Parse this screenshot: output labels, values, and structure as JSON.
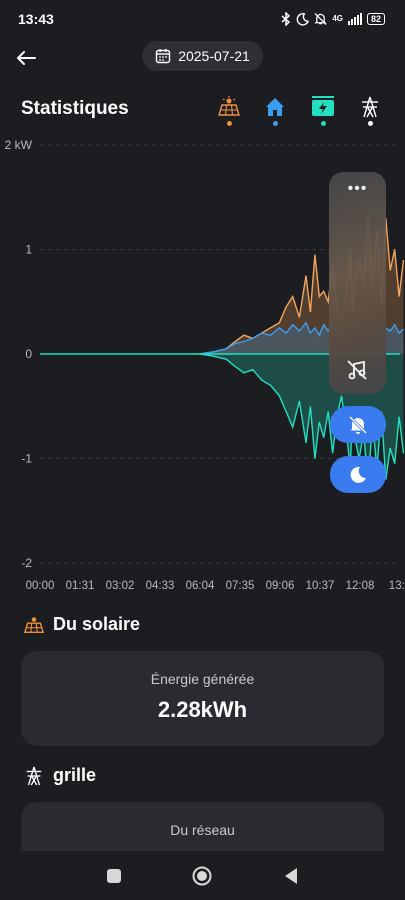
{
  "status_bar": {
    "time": "13:43",
    "network": "4G",
    "battery": "82"
  },
  "header": {
    "date": "2025-07-21",
    "title": "Statistiques"
  },
  "source_tabs": [
    {
      "name": "solar",
      "icon": "solar-panel-icon",
      "dot_color": "#f0923a"
    },
    {
      "name": "home",
      "icon": "home-icon",
      "dot_color": "#3a9ef0"
    },
    {
      "name": "battery",
      "icon": "battery-charging-icon",
      "dot_color": "#22e0c0"
    },
    {
      "name": "grid",
      "icon": "power-tower-icon",
      "dot_color": "#ffffff"
    }
  ],
  "chart_data": {
    "type": "line",
    "ylabel": "kW",
    "ylim": [
      -2,
      2
    ],
    "y_ticks": [
      "2 kW",
      "1",
      "0",
      "-1",
      "-2"
    ],
    "x_ticks": [
      "00:00",
      "01:31",
      "03:02",
      "04:33",
      "06:04",
      "07:35",
      "09:06",
      "10:37",
      "12:08",
      "13:3"
    ],
    "series": [
      {
        "id": "solar",
        "color": "#f2a55c",
        "x": [
          "06:00",
          "06:30",
          "07:00",
          "07:20",
          "07:40",
          "08:00",
          "08:20",
          "08:40",
          "09:00",
          "09:15",
          "09:30",
          "09:45",
          "10:00",
          "10:10",
          "10:20",
          "10:30",
          "10:40",
          "10:50",
          "11:00",
          "11:10",
          "11:20",
          "11:30",
          "11:40",
          "11:45",
          "11:50",
          "12:00",
          "12:10",
          "12:20",
          "12:30",
          "12:40",
          "12:50",
          "13:00",
          "13:10",
          "13:20",
          "13:30",
          "13:40"
        ],
        "y": [
          0.0,
          0.02,
          0.05,
          0.12,
          0.18,
          0.15,
          0.2,
          0.25,
          0.3,
          0.45,
          0.55,
          0.35,
          0.75,
          0.4,
          0.95,
          0.55,
          0.6,
          0.5,
          0.85,
          0.45,
          0.3,
          0.55,
          1.0,
          0.4,
          0.7,
          0.9,
          0.65,
          1.35,
          0.6,
          1.2,
          0.45,
          1.3,
          0.8,
          1.0,
          0.55,
          0.9
        ]
      },
      {
        "id": "home",
        "color": "#3a9ef0",
        "x": [
          "06:00",
          "06:30",
          "07:00",
          "07:20",
          "07:40",
          "08:00",
          "08:20",
          "08:40",
          "09:00",
          "09:15",
          "09:30",
          "09:45",
          "10:00",
          "10:10",
          "10:20",
          "10:30",
          "10:40",
          "10:50",
          "11:00",
          "11:10",
          "11:20",
          "11:30",
          "11:40",
          "11:45",
          "11:50",
          "12:00",
          "12:10",
          "12:20",
          "12:30",
          "12:40",
          "12:50",
          "13:00",
          "13:10",
          "13:20",
          "13:30",
          "13:40"
        ],
        "y": [
          0.0,
          0.02,
          0.05,
          0.1,
          0.12,
          0.15,
          0.2,
          0.18,
          0.25,
          0.2,
          0.28,
          0.22,
          0.3,
          0.2,
          0.25,
          0.18,
          0.28,
          0.22,
          0.3,
          0.2,
          0.25,
          0.22,
          0.3,
          0.18,
          0.25,
          0.28,
          0.2,
          0.25,
          0.22,
          0.28,
          0.2,
          0.25,
          0.22,
          0.28,
          0.2,
          0.24
        ]
      },
      {
        "id": "battery",
        "color": "#22e0c0",
        "x": [
          "06:00",
          "06:30",
          "07:00",
          "07:20",
          "07:40",
          "08:00",
          "08:20",
          "08:40",
          "09:00",
          "09:15",
          "09:30",
          "09:45",
          "10:00",
          "10:10",
          "10:20",
          "10:30",
          "10:40",
          "10:50",
          "11:00",
          "11:10",
          "11:20",
          "11:30",
          "11:40",
          "11:45",
          "11:50",
          "12:00",
          "12:10",
          "12:20",
          "12:30",
          "12:40",
          "12:50",
          "13:00",
          "13:10",
          "13:20",
          "13:30",
          "13:40"
        ],
        "y": [
          0.0,
          -0.02,
          -0.05,
          -0.12,
          -0.18,
          -0.15,
          -0.25,
          -0.3,
          -0.4,
          -0.55,
          -0.7,
          -0.45,
          -0.85,
          -0.5,
          -1.0,
          -0.65,
          -0.8,
          -0.55,
          -0.95,
          -0.6,
          -0.4,
          -0.7,
          -1.1,
          -0.5,
          -0.8,
          -1.0,
          -0.75,
          -1.25,
          -0.65,
          -1.1,
          -0.55,
          -1.2,
          -0.9,
          -1.05,
          -0.6,
          -0.95
        ]
      }
    ]
  },
  "solar_section": {
    "title": "Du solaire",
    "card_label": "Énergie générée",
    "card_value": "2.28kWh"
  },
  "grid_section": {
    "title": "grille",
    "card_label": "Du réseau"
  },
  "floating": {
    "more_label": "•••"
  }
}
